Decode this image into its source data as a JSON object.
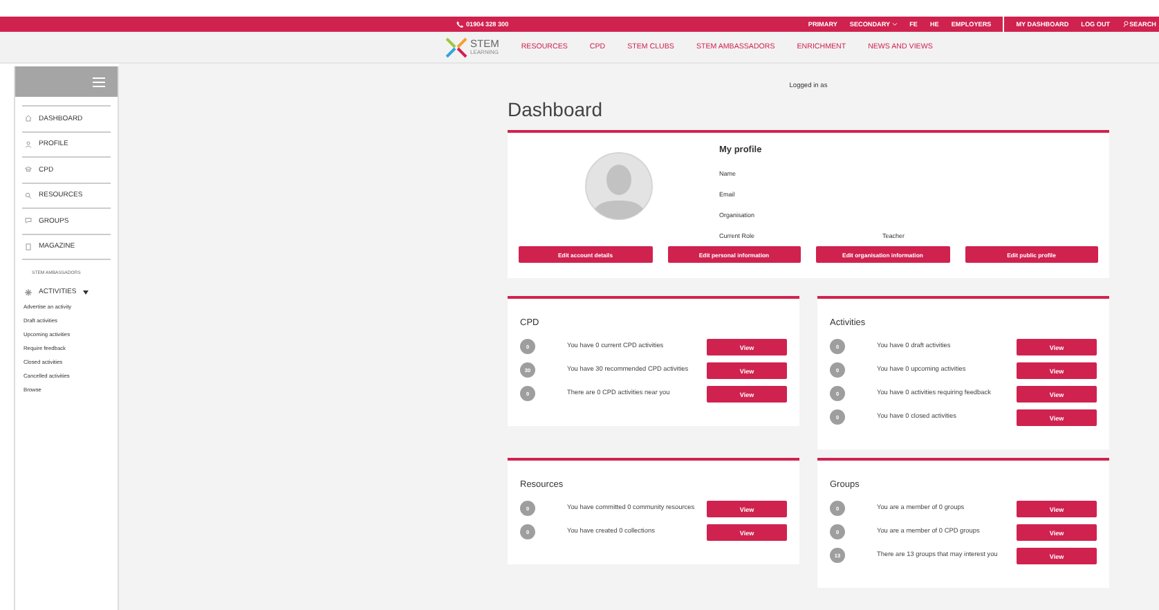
{
  "top_bar": {
    "phone": "01904 328 300",
    "links": [
      {
        "label": "PRIMARY",
        "dropdown": false
      },
      {
        "label": "SECONDARY",
        "dropdown": true
      },
      {
        "label": "FE",
        "dropdown": false
      },
      {
        "label": "HE",
        "dropdown": false
      },
      {
        "label": "EMPLOYERS",
        "dropdown": false
      }
    ],
    "account_links": [
      {
        "label": "MY DASHBOARD",
        "kind": "link"
      },
      {
        "label": "LOG OUT",
        "kind": "link"
      },
      {
        "label": "SEARCH",
        "kind": "search"
      }
    ]
  },
  "nav": {
    "logo": "STEM",
    "logo_sub": "LEARNING",
    "items": [
      "RESOURCES",
      "CPD",
      "STEM CLUBS",
      "STEM AMBASSADORS",
      "ENRICHMENT",
      "NEWS AND VIEWS"
    ]
  },
  "sidebar": {
    "items": [
      {
        "label": "DASHBOARD",
        "kind": "home"
      },
      {
        "label": "PROFILE",
        "kind": "person"
      },
      {
        "label": "CPD",
        "kind": "cap"
      },
      {
        "label": "RESOURCES",
        "kind": "search"
      },
      {
        "label": "GROUPS",
        "kind": "chat"
      },
      {
        "label": "MAGAZINE",
        "kind": "book"
      }
    ],
    "section": "STEM AMBASSADORS",
    "activities": {
      "label": "ACTIVITIES",
      "expanded": true,
      "children": [
        "Advertise an activity",
        "Draft activities",
        "Upcoming activities",
        "Require feedback",
        "Closed activities",
        "Cancelled activities",
        "Browse"
      ]
    }
  },
  "main": {
    "logged_in": "Logged in as",
    "title": "Dashboard",
    "profile": {
      "title": "My profile",
      "fields": [
        {
          "label": "Name"
        },
        {
          "label": "Email"
        },
        {
          "label": "Organisation"
        },
        {
          "label": "Current Role",
          "value": "Teacher"
        }
      ],
      "buttons": [
        "Edit account details",
        "Edit personal information",
        "Edit organisation information",
        "Edit public profile"
      ]
    },
    "cards": [
      {
        "title": "CPD",
        "rows": [
          {
            "count": "0",
            "text": "You have 0 current CPD activities",
            "button": "View"
          },
          {
            "count": "30",
            "text": "You have 30 recommended CPD activities",
            "button": "View"
          },
          {
            "count": "0",
            "text": "There are 0 CPD activities near you",
            "button": "View"
          }
        ]
      },
      {
        "title": "Activities",
        "rows": [
          {
            "count": "0",
            "text": "You have 0 draft activities",
            "button": "View"
          },
          {
            "count": "0",
            "text": "You have 0 upcoming activities",
            "button": "View"
          },
          {
            "count": "0",
            "text": "You have 0 activities requiring feedback",
            "button": "View"
          },
          {
            "count": "0",
            "text": "You have 0 closed activities",
            "button": "View"
          }
        ]
      },
      {
        "title": "Resources",
        "rows": [
          {
            "count": "0",
            "text": "You have committed 0 community resources",
            "button": "View"
          },
          {
            "count": "0",
            "text": "You have created 0 collections",
            "button": "View"
          }
        ]
      },
      {
        "title": "Groups",
        "rows": [
          {
            "count": "0",
            "text": "You are a member of 0 groups",
            "button": "View"
          },
          {
            "count": "0",
            "text": "You are a member of 0 CPD groups",
            "button": "View"
          },
          {
            "count": "13",
            "text": "There are 13 groups that may interest you",
            "button": "View"
          }
        ]
      }
    ]
  }
}
